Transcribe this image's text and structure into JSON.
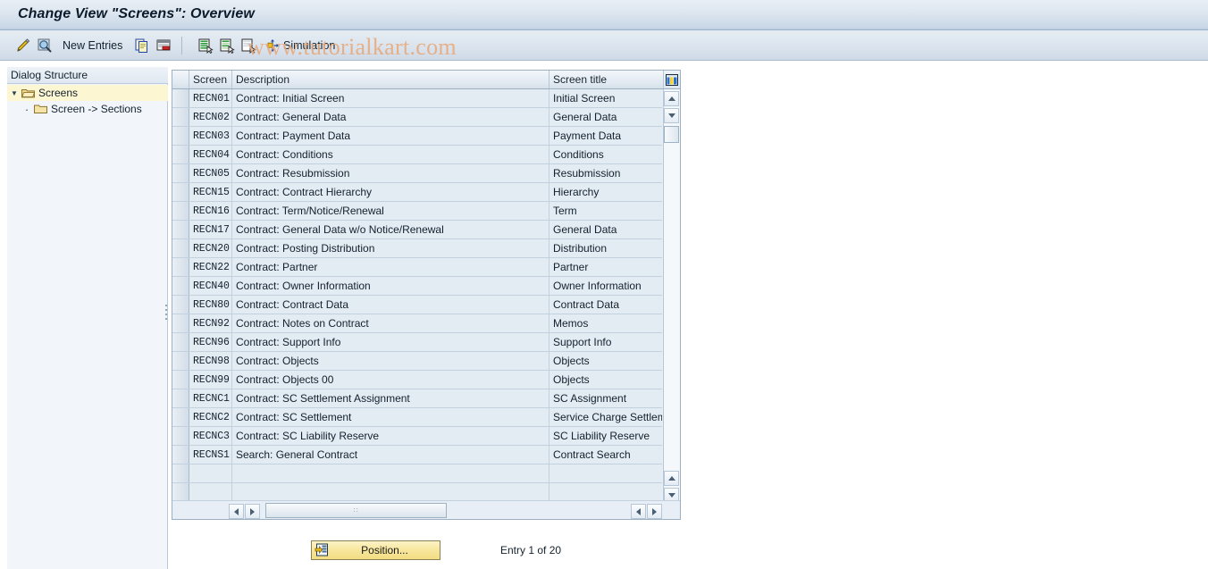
{
  "window": {
    "title": "Change View \"Screens\": Overview"
  },
  "watermark": "www.tutorialkart.com",
  "toolbar": {
    "items": [
      {
        "icon": "pencil-display-change-icon",
        "label": ""
      },
      {
        "icon": "magnifier-display-icon",
        "label": ""
      },
      {
        "icon": "new-entries-label",
        "label": "New Entries"
      },
      {
        "icon": "copy-icon",
        "label": ""
      },
      {
        "icon": "delete-row-icon",
        "label": ""
      },
      {
        "icon": "select-all-icon",
        "label": ""
      },
      {
        "icon": "select-block-icon",
        "label": ""
      },
      {
        "icon": "deselect-all-icon",
        "label": ""
      },
      {
        "icon": "simulation-icon",
        "label": "Simulation"
      }
    ],
    "new_entries_label": "New Entries",
    "simulation_label": "Simulation"
  },
  "sidebar": {
    "header": "Dialog Structure",
    "items": [
      {
        "label": "Screens",
        "icon": "open-folder-icon",
        "selected": true,
        "level": 0,
        "expander": "▼"
      },
      {
        "label": "Screen -> Sections",
        "icon": "folder-icon",
        "selected": false,
        "level": 1,
        "expander": "·"
      }
    ]
  },
  "table": {
    "columns": [
      "Screen",
      "Description",
      "Screen title"
    ],
    "config_icon": "table-settings-icon",
    "rows": [
      {
        "screen": "RECN01",
        "description": "Contract: Initial Screen",
        "title": "Initial Screen"
      },
      {
        "screen": "RECN02",
        "description": "Contract: General Data",
        "title": "General Data"
      },
      {
        "screen": "RECN03",
        "description": "Contract: Payment Data",
        "title": "Payment Data"
      },
      {
        "screen": "RECN04",
        "description": "Contract: Conditions",
        "title": "Conditions"
      },
      {
        "screen": "RECN05",
        "description": "Contract: Resubmission",
        "title": "Resubmission"
      },
      {
        "screen": "RECN15",
        "description": "Contract: Contract Hierarchy",
        "title": "Hierarchy"
      },
      {
        "screen": "RECN16",
        "description": "Contract: Term/Notice/Renewal",
        "title": "Term"
      },
      {
        "screen": "RECN17",
        "description": "Contract: General Data w/o Notice/Renewal",
        "title": "General Data"
      },
      {
        "screen": "RECN20",
        "description": "Contract: Posting Distribution",
        "title": "Distribution"
      },
      {
        "screen": "RECN22",
        "description": "Contract: Partner",
        "title": "Partner"
      },
      {
        "screen": "RECN40",
        "description": "Contract: Owner Information",
        "title": "Owner Information"
      },
      {
        "screen": "RECN80",
        "description": "Contract: Contract Data",
        "title": "Contract Data"
      },
      {
        "screen": "RECN92",
        "description": "Contract: Notes on Contract",
        "title": "Memos"
      },
      {
        "screen": "RECN96",
        "description": "Contract: Support Info",
        "title": "Support Info"
      },
      {
        "screen": "RECN98",
        "description": "Contract: Objects",
        "title": "Objects"
      },
      {
        "screen": "RECN99",
        "description": "Contract: Objects 00",
        "title": "Objects"
      },
      {
        "screen": "RECNC1",
        "description": "Contract: SC Settlement Assignment",
        "title": "SC Assignment"
      },
      {
        "screen": "RECNC2",
        "description": "Contract: SC Settlement",
        "title": "Service Charge Settlem"
      },
      {
        "screen": "RECNC3",
        "description": "Contract: SC Liability Reserve",
        "title": "SC Liability Reserve"
      },
      {
        "screen": "RECNS1",
        "description": "Search: General Contract",
        "title": "Contract Search"
      },
      {
        "screen": "",
        "description": "",
        "title": ""
      },
      {
        "screen": "",
        "description": "",
        "title": ""
      }
    ]
  },
  "footer": {
    "position_button": "Position...",
    "entry_status": "Entry 1 of 20"
  },
  "colors": {
    "titlebar_top": "#e8eef5",
    "titlebar_bottom": "#b3c6da",
    "row_bg": "#e3ebf3",
    "selection_highlight": "#fdf6d3",
    "button_yellow": "#f7e79c",
    "watermark": "#e8a97a"
  }
}
